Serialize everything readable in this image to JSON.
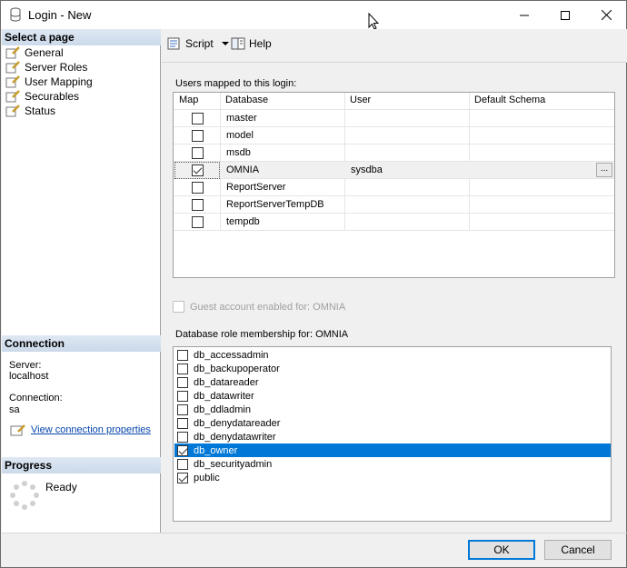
{
  "window": {
    "title": "Login - New"
  },
  "left": {
    "select_page": "Select a page",
    "pages": [
      "General",
      "Server Roles",
      "User Mapping",
      "Securables",
      "Status"
    ],
    "connection_head": "Connection",
    "server_label": "Server:",
    "server_value": "localhost",
    "connection_label": "Connection:",
    "connection_value": "sa",
    "view_props": "View connection properties",
    "progress_head": "Progress",
    "progress_status": "Ready"
  },
  "toolbar": {
    "script": "Script",
    "help": "Help"
  },
  "mapping": {
    "label": "Users mapped to this login:",
    "columns": [
      "Map",
      "Database",
      "User",
      "Default Schema"
    ],
    "rows": [
      {
        "checked": false,
        "db": "master",
        "user": "",
        "schema": ""
      },
      {
        "checked": false,
        "db": "model",
        "user": "",
        "schema": ""
      },
      {
        "checked": false,
        "db": "msdb",
        "user": "",
        "schema": ""
      },
      {
        "checked": true,
        "db": "OMNIA",
        "user": "sysdba",
        "schema": "",
        "ellipsis": "..."
      },
      {
        "checked": false,
        "db": "ReportServer",
        "user": "",
        "schema": ""
      },
      {
        "checked": false,
        "db": "ReportServerTempDB",
        "user": "",
        "schema": ""
      },
      {
        "checked": false,
        "db": "tempdb",
        "user": "",
        "schema": ""
      }
    ]
  },
  "guest": {
    "label": "Guest account enabled for: OMNIA",
    "checked": false
  },
  "roles": {
    "label": "Database role membership for: OMNIA",
    "items": [
      {
        "name": "db_accessadmin",
        "checked": false
      },
      {
        "name": "db_backupoperator",
        "checked": false
      },
      {
        "name": "db_datareader",
        "checked": false
      },
      {
        "name": "db_datawriter",
        "checked": false
      },
      {
        "name": "db_ddladmin",
        "checked": false
      },
      {
        "name": "db_denydatareader",
        "checked": false
      },
      {
        "name": "db_denydatawriter",
        "checked": false
      },
      {
        "name": "db_owner",
        "checked": true
      },
      {
        "name": "db_securityadmin",
        "checked": false
      },
      {
        "name": "public",
        "checked": true
      }
    ]
  },
  "buttons": {
    "ok": "OK",
    "cancel": "Cancel"
  }
}
